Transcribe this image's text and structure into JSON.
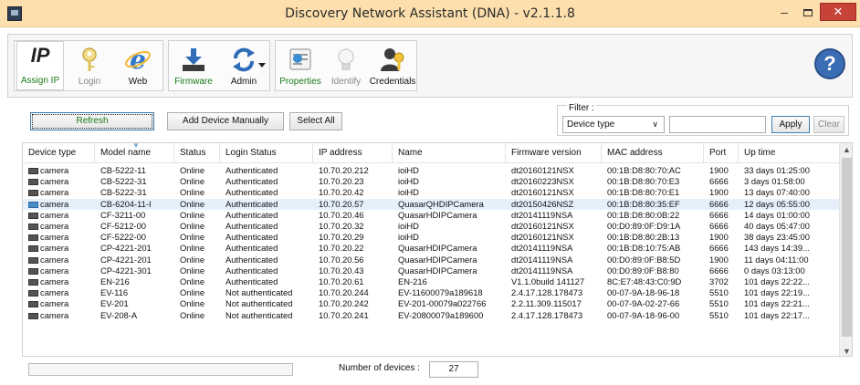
{
  "window": {
    "title": "Discovery Network Assistant (DNA) - v2.1.1.8",
    "minimize_glyph": "–",
    "close_glyph": "✕"
  },
  "toolbar": {
    "buttons": [
      {
        "label": "Assign IP",
        "icon": "ip-icon",
        "enabled": true
      },
      {
        "label": "Login",
        "icon": "key-icon",
        "enabled": false
      },
      {
        "label": "Web",
        "icon": "browser-icon",
        "enabled": true
      },
      {
        "label": "Firmware",
        "icon": "download-icon",
        "enabled": true
      },
      {
        "label": "Admin",
        "icon": "refresh-arrows-icon",
        "enabled": true
      },
      {
        "label": "Properties",
        "icon": "properties-icon",
        "enabled": true
      },
      {
        "label": "Identify",
        "icon": "bulb-icon",
        "enabled": false
      },
      {
        "label": "Credentials",
        "icon": "user-key-icon",
        "enabled": true
      }
    ],
    "ip_text": "IP",
    "help_glyph": "?"
  },
  "actions": {
    "refresh": "Refresh",
    "add_device": "Add Device Manually",
    "select_all": "Select All"
  },
  "filter": {
    "label": "Filter :",
    "selected": "Device type",
    "chevron": "∨",
    "value": "",
    "apply": "Apply",
    "clear": "Clear"
  },
  "table": {
    "columns": [
      "Device type",
      "Model name",
      "Status",
      "Login Status",
      "IP address",
      "Name",
      "Firmware version",
      "MAC address",
      "Port",
      "Up time"
    ],
    "sort_caret": "▼",
    "selected_row": 3,
    "rows": [
      [
        "camera",
        "CB-5222-11",
        "Online",
        "Authenticated",
        "10.70.20.212",
        "ioiHD",
        "dt20160121NSX",
        "00:1B:D8:80:70:AC",
        "1900",
        "33 days 01:25:00"
      ],
      [
        "camera",
        "CB-5222-31",
        "Online",
        "Authenticated",
        "10.70.20.23",
        "ioiHD",
        "dt20160223NSX",
        "00:1B:D8:80:70:E3",
        "6666",
        "3 days 01:58:00"
      ],
      [
        "camera",
        "CB-5222-31",
        "Online",
        "Authenticated",
        "10.70.20.42",
        "ioiHD",
        "dt20160121NSX",
        "00:1B:D8:80:70:E1",
        "1900",
        "13 days 07:40:00"
      ],
      [
        "camera",
        "CB-6204-11-I",
        "Online",
        "Authenticated",
        "10.70.20.57",
        "QuasarQHDIPCamera",
        "dt20150426NSZ",
        "00:1B:D8:80:35:EF",
        "6666",
        "12 days 05:55:00"
      ],
      [
        "camera",
        "CF-3211-00",
        "Online",
        "Authenticated",
        "10.70.20.46",
        "QuasarHDIPCamera",
        "dt20141119NSA",
        "00:1B:D8:80:0B:22",
        "6666",
        "14 days 01:00:00"
      ],
      [
        "camera",
        "CF-5212-00",
        "Online",
        "Authenticated",
        "10.70.20.32",
        "ioiHD",
        "dt20160121NSX",
        "00:D0:89:0F:D9:1A",
        "6666",
        "40 days 05:47:00"
      ],
      [
        "camera",
        "CF-5222-00",
        "Online",
        "Authenticated",
        "10.70.20.29",
        "ioiHD",
        "dt20160121NSX",
        "00:1B:D8:80:2B:13",
        "1900",
        "38 days 23:45:00"
      ],
      [
        "camera",
        "CP-4221-201",
        "Online",
        "Authenticated",
        "10.70.20.22",
        "QuasarHDIPCamera",
        "dt20141119NSA",
        "00:1B:D8:10:75:AB",
        "6666",
        "143 days 14:39..."
      ],
      [
        "camera",
        "CP-4221-201",
        "Online",
        "Authenticated",
        "10.70.20.56",
        "QuasarHDIPCamera",
        "dt20141119NSA",
        "00:D0:89:0F:B8:5D",
        "1900",
        "11 days 04:11:00"
      ],
      [
        "camera",
        "CP-4221-301",
        "Online",
        "Authenticated",
        "10.70.20.43",
        "QuasarHDIPCamera",
        "dt20141119NSA",
        "00:D0:89:0F:B8:80",
        "6666",
        "0 days 03:13:00"
      ],
      [
        "camera",
        "EN-216",
        "Online",
        "Authenticated",
        "10.70.20.61",
        "EN-216",
        "V1.1.0build 141127",
        "8C:E7:48:43:C0:9D",
        "3702",
        "101 days 22:22..."
      ],
      [
        "camera",
        "EV-116",
        "Online",
        "Not authenticated",
        "10.70.20.244",
        "EV-11600079a189618",
        "2.4.17.128.178473",
        "00-07-9A-18-96-18",
        "5510",
        "101 days 22:19..."
      ],
      [
        "camera",
        "EV-201",
        "Online",
        "Not authenticated",
        "10.70.20.242",
        "EV-201-00079a022766",
        "2.2.11.309.115017",
        "00-07-9A-02-27-66",
        "5510",
        "101 days 22:21..."
      ],
      [
        "camera",
        "EV-208-A",
        "Online",
        "Not authenticated",
        "10.70.20.241",
        "EV-20800079a189600",
        "2.4.17.128.178473",
        "00-07-9A-18-96-00",
        "5510",
        "101 days 22:17..."
      ]
    ]
  },
  "scrollbar": {
    "up": "▲",
    "down": "▼"
  },
  "status": {
    "progress": 0.0,
    "count_label": "Number of devices :",
    "count_value": "27"
  }
}
